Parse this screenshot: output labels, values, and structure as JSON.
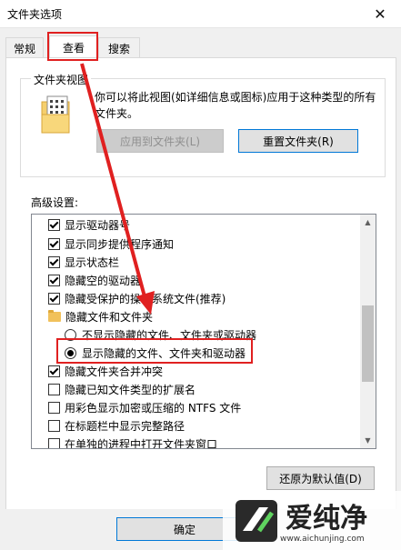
{
  "window": {
    "title": "文件夹选项",
    "close_glyph": "✕"
  },
  "tabs": [
    {
      "label": "常规"
    },
    {
      "label": "查看"
    },
    {
      "label": "搜索"
    }
  ],
  "folder_view": {
    "group_title": "文件夹视图",
    "description": "你可以将此视图(如详细信息或图标)应用于这种类型的所有文件夹。",
    "apply_label": "应用到文件夹(L)",
    "reset_label": "重置文件夹(R)"
  },
  "advanced": {
    "label": "高级设置:",
    "items": [
      {
        "type": "checkbox",
        "checked": true,
        "label": "显示驱动器号"
      },
      {
        "type": "checkbox",
        "checked": true,
        "label": "显示同步提供程序通知"
      },
      {
        "type": "checkbox",
        "checked": true,
        "label": "显示状态栏"
      },
      {
        "type": "checkbox",
        "checked": true,
        "label": "隐藏空的驱动器"
      },
      {
        "type": "checkbox",
        "checked": true,
        "label": "隐藏受保护的操作系统文件(推荐)"
      },
      {
        "type": "folder",
        "label": "隐藏文件和文件夹"
      },
      {
        "type": "radio",
        "checked": false,
        "label": "不显示隐藏的文件、文件夹或驱动器"
      },
      {
        "type": "radio",
        "checked": true,
        "label": "显示隐藏的文件、文件夹和驱动器"
      },
      {
        "type": "checkbox",
        "checked": true,
        "label": "隐藏文件夹合并冲突"
      },
      {
        "type": "checkbox",
        "checked": false,
        "label": "隐藏已知文件类型的扩展名"
      },
      {
        "type": "checkbox",
        "checked": false,
        "label": "用彩色显示加密或压缩的 NTFS 文件"
      },
      {
        "type": "checkbox",
        "checked": false,
        "label": "在标题栏中显示完整路径"
      },
      {
        "type": "checkbox",
        "checked": false,
        "label": "在单独的进程中打开文件夹窗口"
      }
    ],
    "restore_label": "还原为默认值(D)"
  },
  "footer": {
    "ok_label": "确定"
  },
  "watermark": {
    "brand": "爱纯净",
    "url": "www.aichunjing.com"
  },
  "colors": {
    "highlight": "#e02020",
    "accent": "#0078d7"
  }
}
